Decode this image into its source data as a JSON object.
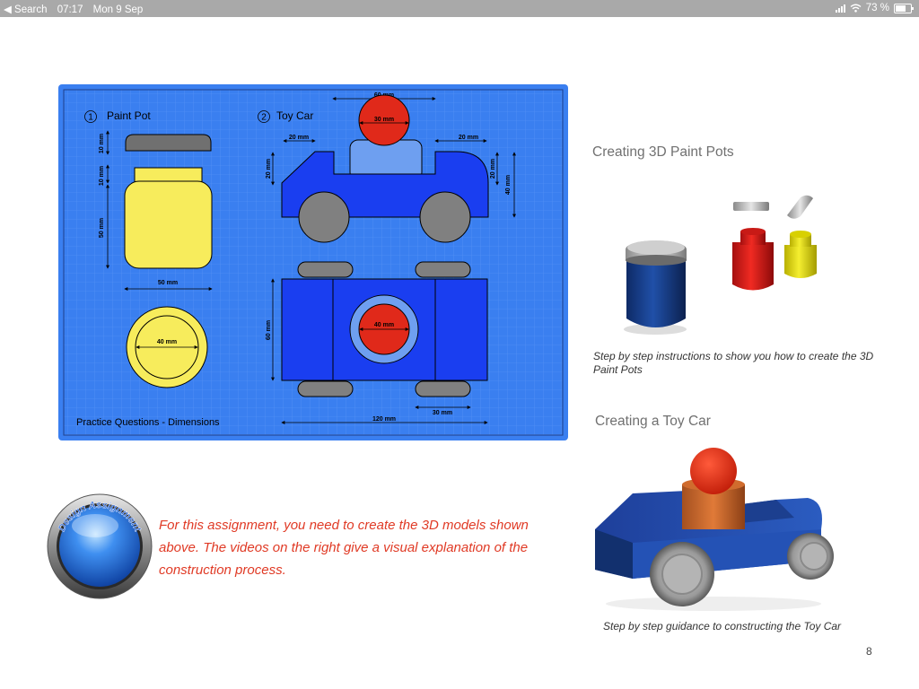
{
  "status_bar": {
    "back_label": "◀ Search",
    "time": "07:17",
    "date": "Mon 9 Sep",
    "battery": "73 %"
  },
  "blueprint": {
    "item1_number": "1",
    "item1_title": "Paint Pot",
    "item2_number": "2",
    "item2_title": "Toy Car",
    "footer": "Practice Questions - Dimensions",
    "dims": {
      "pp_lid_h": "10 mm",
      "pp_neck_h": "10 mm",
      "pp_body_h": "50 mm",
      "pp_width": "50 mm",
      "pp_top_dia": "40 mm",
      "car_head_w": "60 mm",
      "car_head_dia": "30 mm",
      "car_left_w": "20 mm",
      "car_right_w": "20 mm",
      "car_side_h": "20 mm",
      "car_right_h": "20 mm",
      "car_total_h": "40 mm",
      "car_top_h": "60 mm",
      "car_top_dia": "40 mm",
      "car_wheel_w": "30 mm",
      "car_length": "120 mm"
    }
  },
  "paint_pots": {
    "heading": "Creating 3D Paint Pots",
    "caption": "Step by step instructions to show you how to create the 3D Paint Pots"
  },
  "toy_car": {
    "heading": "Creating a Toy Car",
    "caption": "Step by step guidance to constructing the Toy Car"
  },
  "badge": {
    "label": "Design Assignment"
  },
  "assignment_text": "For this assignment, you need to create the 3D models shown above.  The videos on the right give a visual explanation of the construction process.",
  "page_number": "8",
  "colors": {
    "blueprint_bg": "#3a7ff0",
    "paint_yellow": "#f7ec5c",
    "car_blue": "#1a3ef0",
    "head_red": "#e0291a",
    "assignment_red": "#e03a25"
  }
}
